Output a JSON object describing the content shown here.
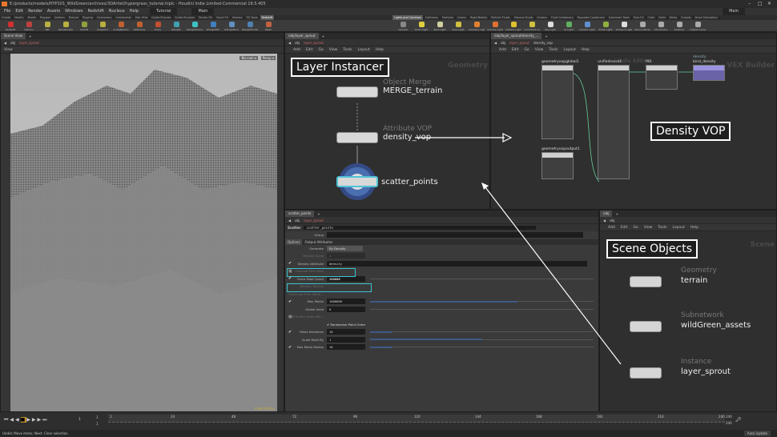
{
  "window": {
    "title": "E:/products/models/HYP101_WildGreen/archives/3DArtist/hypergrass_tutorial.hiplc - Houdini Indie Limited-Commercial 16.5.405",
    "minimize": "–",
    "maximize": "□",
    "close": "✕"
  },
  "menu": [
    "File",
    "Edit",
    "Render",
    "Assets",
    "Windows",
    "Redshift",
    "Nucleus",
    "Help"
  ],
  "desktop_left": "Tutorial",
  "desktop_center": "Main",
  "desktop_right": "Main",
  "shelf_left": {
    "tabs": [
      "Create",
      "Modify",
      "Model",
      "Polygon",
      "Deform",
      "Texture",
      "Rigging",
      "Characters",
      "Constraints",
      "Hair Utils",
      "Guide Process",
      "Guide Brushes",
      "Terrain FX",
      "Cloud FX",
      "Volume",
      "TD Tools",
      "Redshift"
    ],
    "active": "Redshift",
    "tools": [
      {
        "l": "Redshift",
        "c": "#d03030"
      },
      {
        "l": "Options",
        "c": "#c04040"
      },
      {
        "l": "IPR",
        "c": "#b8b040"
      },
      {
        "l": "RenderView",
        "c": "#b8b040"
      },
      {
        "l": "On/Off",
        "c": "#90a040"
      },
      {
        "l": "Snapshot",
        "c": "#b8b040"
      },
      {
        "l": "ConfigRenders",
        "c": "#c06030"
      },
      {
        "l": "RSProxies",
        "c": "#c06030"
      },
      {
        "l": "Proxy",
        "c": "#c05030"
      },
      {
        "l": "RSLight",
        "c": "#40a0b0"
      },
      {
        "l": "RSLightDome",
        "c": "#40c0c0"
      },
      {
        "l": "RSLightIES",
        "c": "#4080c0"
      },
      {
        "l": "RSLightSun",
        "c": "#6090c0"
      },
      {
        "l": "RSLightPortal",
        "c": "#5080b0"
      },
      {
        "l": "Mesh",
        "c": "#c06040"
      }
    ]
  },
  "shelf_right": {
    "tabs": [
      "Lights and Cameras",
      "Collisions",
      "Particles",
      "Grains",
      "Rigid Bodies",
      "Particle Fluids",
      "Viscous Fluids",
      "Oceans",
      "Fluid Containers",
      "Populate Containers",
      "Container Tools",
      "Pyro FX",
      "Cloth",
      "Solid",
      "Wires",
      "Crowds",
      "Drive Simulation"
    ],
    "active": "Lights and Cameras",
    "tools": [
      {
        "l": "Camera",
        "c": "#888"
      },
      {
        "l": "Point Light",
        "c": "#e0d040"
      },
      {
        "l": "Spot Light",
        "c": "#d0d0a0"
      },
      {
        "l": "Area Light",
        "c": "#d0c040"
      },
      {
        "l": "Geometry Light",
        "c": "#e08030"
      },
      {
        "l": "Volume Light",
        "c": "#e07030"
      },
      {
        "l": "Distant Light",
        "c": "#e0c030"
      },
      {
        "l": "Environment Light",
        "c": "#d0c040"
      },
      {
        "l": "Sky Light",
        "c": "#ddd"
      },
      {
        "l": "GI Light",
        "c": "#60b060"
      },
      {
        "l": "Caustic Light",
        "c": "#6090d0"
      },
      {
        "l": "Portal Light",
        "c": "#90b040"
      },
      {
        "l": "Ambient Light",
        "c": "#ddd"
      },
      {
        "l": "Stereo Camera",
        "c": "#aaa"
      },
      {
        "l": "VR Camera",
        "c": "#aaa"
      },
      {
        "l": "Switcher",
        "c": "#aaa"
      },
      {
        "l": "Gamepad Camera",
        "c": "#aaa"
      }
    ]
  },
  "scene_view": {
    "tab": "Scene View",
    "path": [
      "obj",
      "layer_sprout"
    ],
    "view_label": "View",
    "persp": "Persp ▾",
    "cam": "No cam ▾",
    "watermark": "Indie Edition"
  },
  "net_left": {
    "tab": "/obj/layer_sprout",
    "path": [
      "obj",
      "layer_sprout"
    ],
    "menu": [
      "Add",
      "Edit",
      "Go",
      "View",
      "Tools",
      "Layout",
      "Help"
    ],
    "context": "Geometry",
    "callout": "Layer Instancer",
    "nodes": [
      {
        "type": "Object Merge",
        "name": "MERGE_terrain"
      },
      {
        "type": "Attribute VOP",
        "name": "density_vop"
      },
      {
        "type": "",
        "name": "scatter_points"
      }
    ]
  },
  "net_vop": {
    "tab": "/obj/layer_sprout/density_...",
    "path": [
      "obj",
      "layer_sprout",
      "density_vop"
    ],
    "menu": [
      "Add",
      "Edit",
      "Go",
      "View",
      "Tools",
      "Layout",
      "Help"
    ],
    "context": "VEX Builder",
    "watermark": "Indie Edition",
    "callout": "Density VOP",
    "nodes": [
      {
        "name": "geometryvopglobal1"
      },
      {
        "name": "unifiednoise1"
      },
      {
        "name": "fit1"
      },
      {
        "type": "density",
        "name": "bind_density"
      },
      {
        "name": "geometryvopoutput1"
      }
    ]
  },
  "params": {
    "tab": "scatter_points",
    "path": [
      "obj",
      "layer_sprout"
    ],
    "node_type": "Scatter",
    "node_name": "scatter_points",
    "group_label": "Group",
    "tabs": [
      "Options",
      "Output Attributes"
    ],
    "generate": {
      "label": "Generate",
      "value": "By Density"
    },
    "density_scale": {
      "label": "Density Scale",
      "value": "1"
    },
    "density_attribute": {
      "label": "Density Attribute",
      "value": "density"
    },
    "override_prim": {
      "label": "Override Prim Area"
    },
    "force_total": {
      "label": "Force Total Count",
      "value": "100000"
    },
    "density_texture": {
      "label": "Density Texture"
    },
    "count_per_prim": {
      "label": "Count per Prim Attrib..."
    },
    "max_points": {
      "label": "Max Points",
      "value": "1000000",
      "fill": 0.66
    },
    "global_seed": {
      "label": "Global Seed",
      "value": "0",
      "fill": 0
    },
    "prim_seed": {
      "label": "Primitive Seed Attr..."
    },
    "randomize": "Randomize Point Order",
    "relax_iter": {
      "label": "Relax Iterations",
      "value": "10",
      "fill": 0.1
    },
    "scale_radii": {
      "label": "Scale Radii By",
      "value": "1",
      "fill": 0.5
    },
    "max_relax": {
      "label": "Max Relax Radius",
      "value": "10",
      "fill": 0.1
    }
  },
  "net_scene": {
    "tab": "/obj",
    "path": [
      "obj"
    ],
    "menu": [
      "Add",
      "Edit",
      "Go",
      "View",
      "Tools",
      "Layout",
      "Help"
    ],
    "context": "Scene",
    "callout": "Scene Objects",
    "nodes": [
      {
        "type": "Geometry",
        "name": "terrain"
      },
      {
        "type": "Subnetwork",
        "name": "wildGreen_assets"
      },
      {
        "type": "Instance",
        "name": "layer_sprout"
      }
    ]
  },
  "timeline": {
    "current_frame": "1",
    "start": "1",
    "start2": "1",
    "ticks": [
      "1",
      "24",
      "48",
      "72",
      "96",
      "120",
      "144",
      "168",
      "192",
      "216",
      "240"
    ],
    "end": "240",
    "end2": "240",
    "auto_update": "Auto Update"
  },
  "status": "Undid: Move items; Next: Clear selection"
}
